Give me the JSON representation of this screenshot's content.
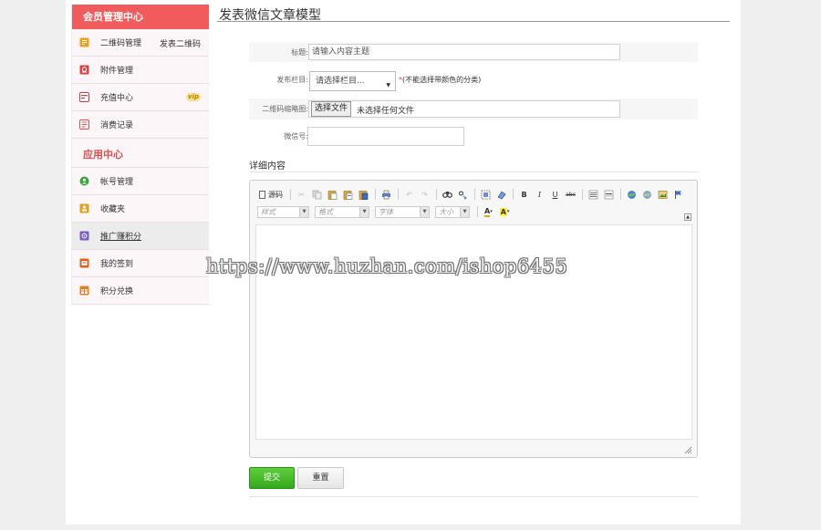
{
  "sidebar": {
    "header": "会员管理中心",
    "items": [
      {
        "label": "二维码管理",
        "extra": "发表二维码",
        "icon": "qrcode-icon",
        "color": "#f0a020"
      },
      {
        "label": "附件管理",
        "icon": "attachment-icon",
        "color": "#e04040"
      },
      {
        "label": "充值中心",
        "badge": "vip",
        "icon": "recharge-icon",
        "color": "#c04040"
      },
      {
        "label": "消费记录",
        "icon": "record-icon",
        "color": "#e05050"
      }
    ],
    "app_header": "应用中心",
    "app_items": [
      {
        "label": "帐号管理",
        "icon": "account-icon",
        "color": "#3aa53a"
      },
      {
        "label": "收藏夹",
        "icon": "favorites-icon",
        "color": "#e0a020"
      },
      {
        "label": "推广赚积分",
        "icon": "promote-icon",
        "color": "#7a5cc0"
      },
      {
        "label": "我的签到",
        "icon": "signin-icon",
        "color": "#e06020"
      },
      {
        "label": "积分兑换",
        "icon": "exchange-icon",
        "color": "#e08020"
      }
    ]
  },
  "main": {
    "title": "发表微信文章模型",
    "form": {
      "title_label": "标题:",
      "title_placeholder": "请输入内容主题",
      "category_label": "发布栏目:",
      "category_value": "请选择栏目...",
      "category_hint_star": "*",
      "category_hint": "(不能选择带颜色的分类)",
      "qrcode_label": "二维码缩略图:",
      "file_button": "选择文件",
      "file_status": "未选择任何文件",
      "wechat_label": "微信号:",
      "wechat_value": ""
    },
    "detail_label": "详细内容",
    "editor": {
      "source_label": "源码",
      "combo_style": "样式",
      "combo_format": "格式",
      "combo_font": "字体",
      "combo_size": "大小"
    },
    "submit_label": "提交",
    "reset_label": "重置"
  },
  "watermark": "https://www.huzhan.com/ishop6455"
}
